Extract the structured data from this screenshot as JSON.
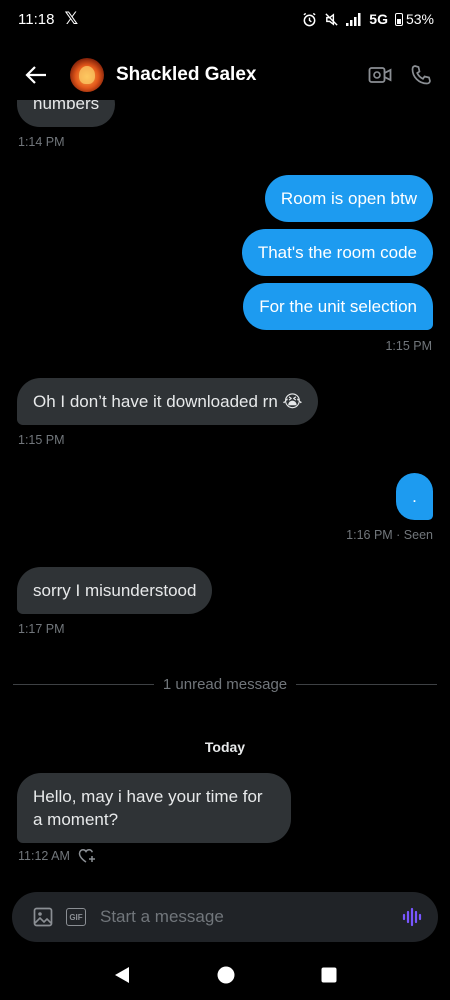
{
  "status": {
    "time": "11:18",
    "app_glyph": "𝕏",
    "network": "5G",
    "battery": "53%"
  },
  "header": {
    "name": "Shackled Galex"
  },
  "messages": [
    {
      "text": "numbers",
      "time": "1:14 PM"
    },
    {
      "text": "Room is open btw"
    },
    {
      "text": "That's the room code"
    },
    {
      "text": "For the unit selection",
      "time": "1:15 PM"
    },
    {
      "text": "Oh I don’t have it downloaded rn 😭",
      "time": "1:15 PM"
    },
    {
      "text": ".",
      "time": "1:16 PM · Seen"
    },
    {
      "text": "sorry I misunderstood",
      "time": "1:17 PM"
    },
    {
      "text": "Hello, may i have your time for a moment?",
      "time": "11:12 AM"
    }
  ],
  "divider": "1 unread message",
  "today": "Today",
  "composer": {
    "placeholder": "Start a message",
    "gif": "GIF"
  },
  "colors": {
    "accent": "#1d9bf0",
    "incoming": "#2f3336",
    "voice": "#7856ff"
  }
}
